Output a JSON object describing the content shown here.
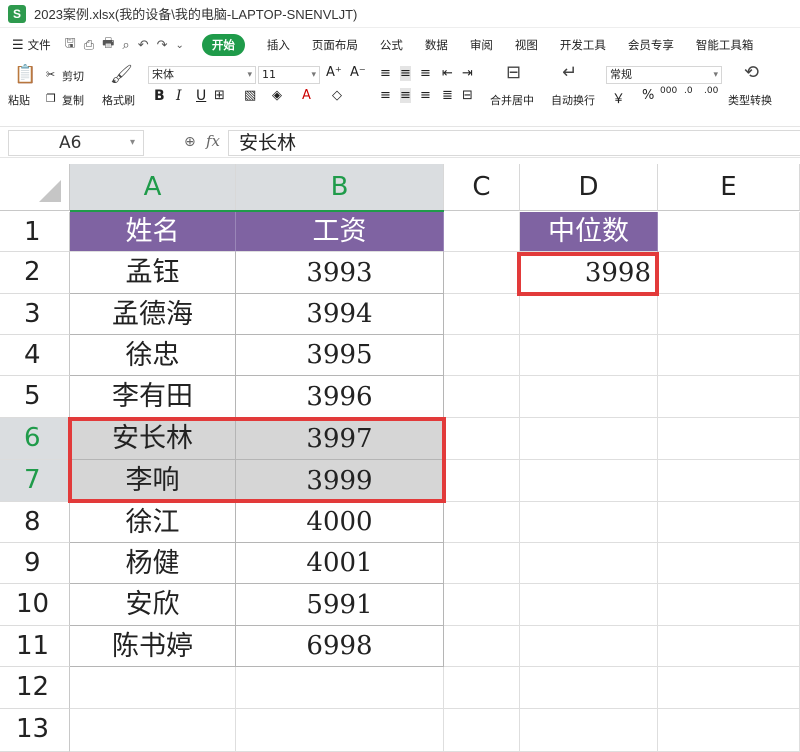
{
  "window": {
    "logo": "S",
    "title": "2023案例.xlsx(我的设备\\我的电脑-LAPTOP-SNENVLJT)"
  },
  "menu": {
    "file": "文件",
    "start": "开始",
    "items": [
      "插入",
      "页面布局",
      "公式",
      "数据",
      "审阅",
      "视图",
      "开发工具",
      "会员专享",
      "智能工具箱"
    ]
  },
  "ribbon": {
    "cut": "剪切",
    "paste": "粘贴",
    "copy": "复制",
    "format_painter": "格式刷",
    "font_name": "宋体",
    "font_size": "11",
    "merge_center": "合并居中",
    "wrap_text": "自动换行",
    "number_format": "常规",
    "type_convert": "类型转换",
    "bold": "B",
    "italic": "I",
    "underline": "U",
    "currency": "￥",
    "percent": "%"
  },
  "formula_bar": {
    "cell_ref": "A6",
    "fx": "fx",
    "content": "安长林"
  },
  "columns": [
    "A",
    "B",
    "C",
    "D",
    "E"
  ],
  "rows": [
    "1",
    "2",
    "3",
    "4",
    "5",
    "6",
    "7",
    "8",
    "9",
    "10",
    "11",
    "12",
    "13"
  ],
  "table": {
    "header": [
      "姓名",
      "工资"
    ],
    "rows": [
      [
        "孟钰",
        "3993"
      ],
      [
        "孟德海",
        "3994"
      ],
      [
        "徐忠",
        "3995"
      ],
      [
        "李有田",
        "3996"
      ],
      [
        "安长林",
        "3997"
      ],
      [
        "李响",
        "3999"
      ],
      [
        "徐江",
        "4000"
      ],
      [
        "杨健",
        "4001"
      ],
      [
        "安欣",
        "5991"
      ],
      [
        "陈书婷",
        "6998"
      ]
    ]
  },
  "median": {
    "header": "中位数",
    "value": "3998"
  },
  "colors": {
    "header_purple": "#7f63a2",
    "selection_green": "#1f9b4a",
    "highlight_red": "#e23a3a"
  }
}
